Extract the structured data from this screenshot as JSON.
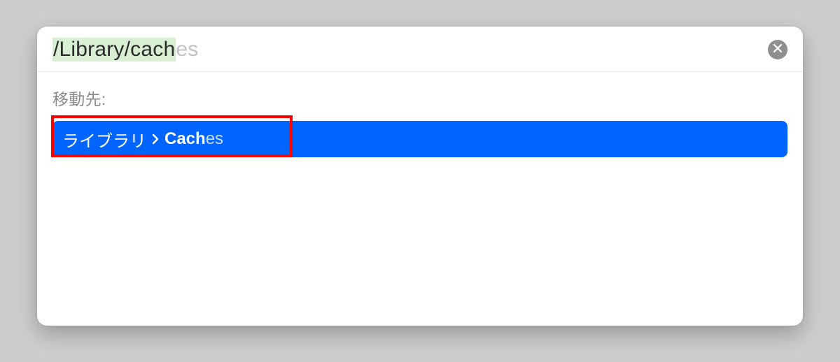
{
  "input": {
    "typed": "/Library/cach",
    "autocomplete_suffix": "es"
  },
  "section_label": "移動先:",
  "result": {
    "crumb1": "ライブラリ",
    "match_bold": "Cach",
    "match_tail": "es"
  }
}
